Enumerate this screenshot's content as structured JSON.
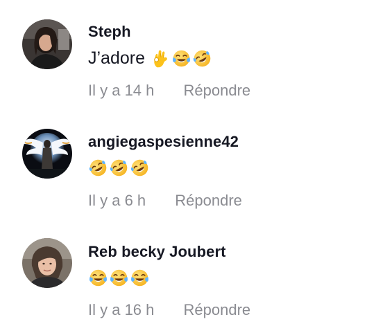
{
  "comments": [
    {
      "username": "Steph",
      "text": "J’adore",
      "emojis": [
        "ok-hand-emoji",
        "tears-of-joy-emoji",
        "rofl-emoji"
      ],
      "time": "Il y a 14 h",
      "reply_label": "Répondre",
      "avatar": "avatar-steph"
    },
    {
      "username": "angiegaspesienne42",
      "text": "",
      "emojis": [
        "rofl-emoji",
        "rofl-emoji",
        "rofl-emoji"
      ],
      "time": "Il y a 6 h",
      "reply_label": "Répondre",
      "avatar": "avatar-angel-wings"
    },
    {
      "username": "Reb becky Joubert",
      "text": "",
      "emojis": [
        "tears-of-joy-emoji",
        "tears-of-joy-emoji",
        "tears-of-joy-emoji"
      ],
      "time": "Il y a 16 h",
      "reply_label": "Répondre",
      "avatar": "avatar-reb"
    }
  ],
  "colors": {
    "text": "#161823",
    "muted": "#8a8b91",
    "emoji_yellow": "#ffc83d",
    "emoji_tear": "#5fb4ff"
  }
}
